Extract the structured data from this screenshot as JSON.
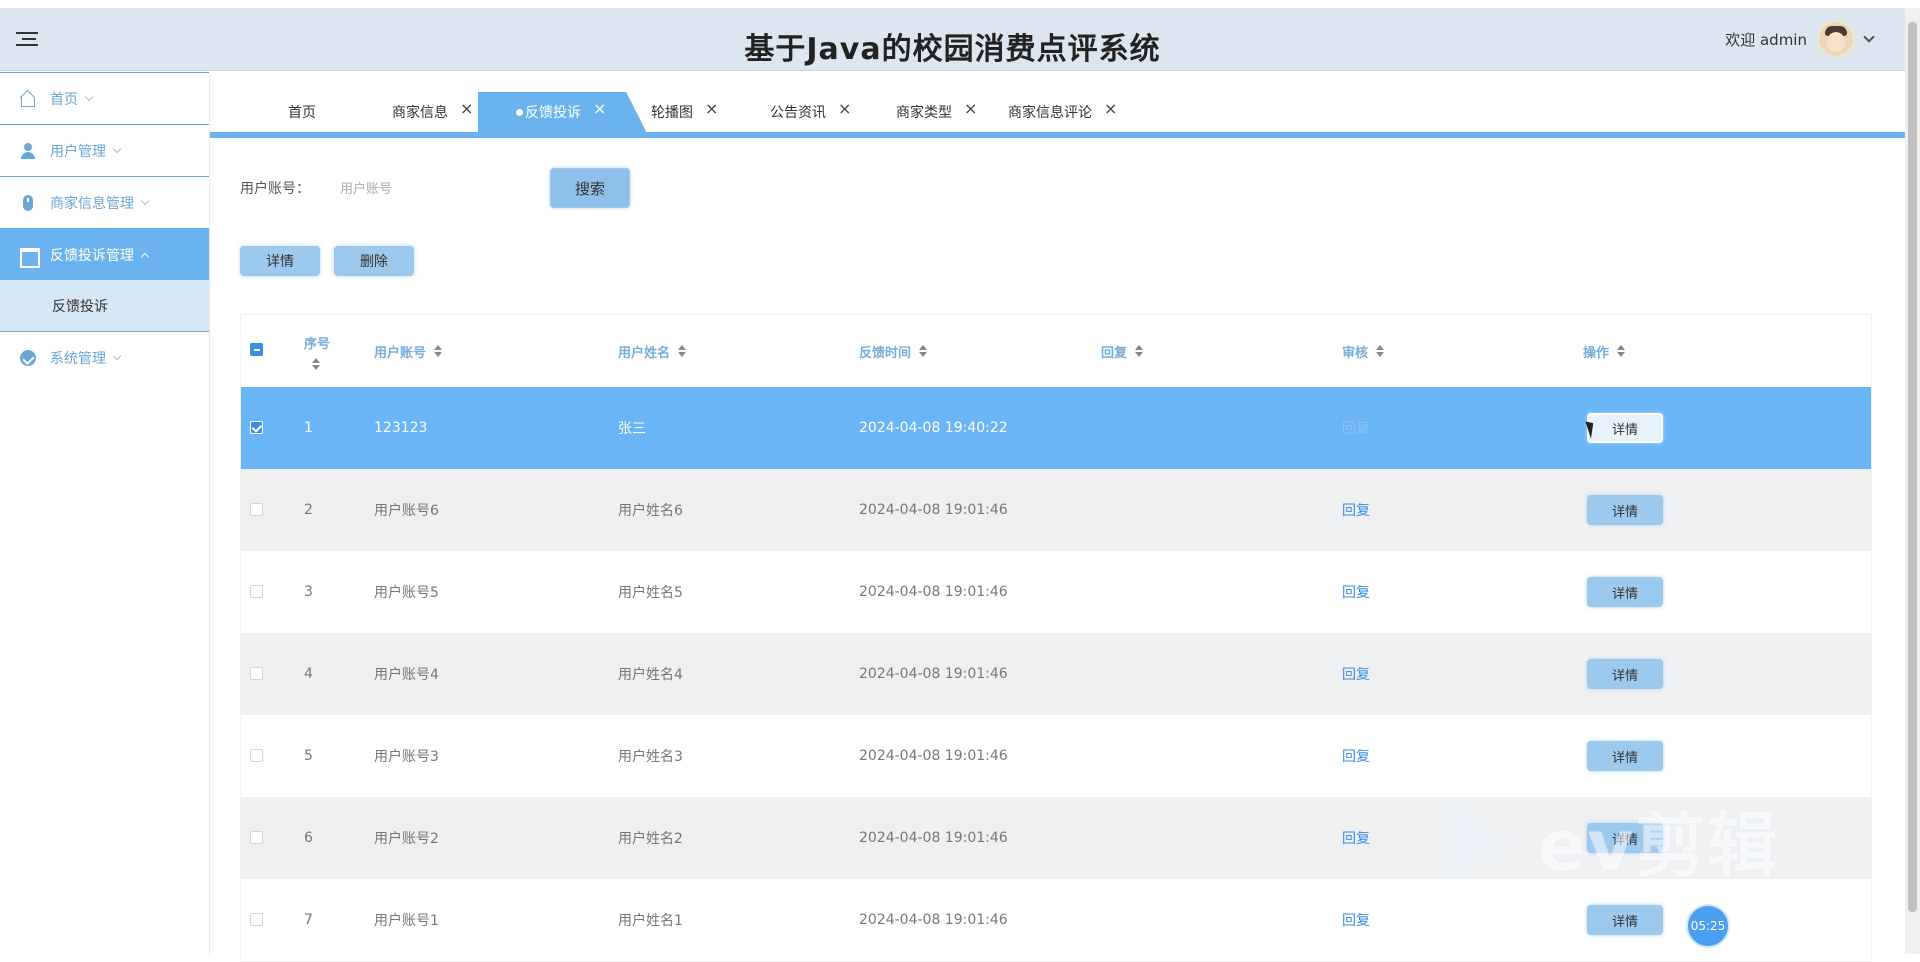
{
  "header": {
    "title": "基于Java的校园消费点评系统",
    "welcome": "欢迎 admin"
  },
  "sidebar": {
    "items": [
      {
        "label": "首页",
        "icon": "home-icon"
      },
      {
        "label": "用户管理",
        "icon": "user-icon"
      },
      {
        "label": "商家信息管理",
        "icon": "merchant-icon"
      },
      {
        "label": "反馈投诉管理",
        "icon": "feedback-icon",
        "active": true
      },
      {
        "label": "系统管理",
        "icon": "system-icon"
      }
    ],
    "sub_item": "反馈投诉"
  },
  "tabs": [
    {
      "label": "首页",
      "closable": false
    },
    {
      "label": "商家信息",
      "closable": true
    },
    {
      "label": "反馈投诉",
      "closable": true,
      "active": true
    },
    {
      "label": "轮播图",
      "closable": true
    },
    {
      "label": "公告资讯",
      "closable": true
    },
    {
      "label": "商家类型",
      "closable": true
    },
    {
      "label": "商家信息评论",
      "closable": true
    }
  ],
  "tab_close": "×",
  "search": {
    "label": "用户账号：",
    "placeholder": "用户账号",
    "button": "搜索"
  },
  "actions": {
    "detail": "详情",
    "delete": "删除"
  },
  "table": {
    "headers": {
      "index": "序号",
      "account": "用户账号",
      "name": "用户姓名",
      "time": "反馈时间",
      "reply": "回复",
      "review": "审核",
      "operation": "操作"
    },
    "reply_link": "回复",
    "detail_button": "详情",
    "rows": [
      {
        "index": "1",
        "account": "123123",
        "name": "张三",
        "time": "2024-04-08 19:40:22",
        "selected": true
      },
      {
        "index": "2",
        "account": "用户账号6",
        "name": "用户姓名6",
        "time": "2024-04-08 19:01:46"
      },
      {
        "index": "3",
        "account": "用户账号5",
        "name": "用户姓名5",
        "time": "2024-04-08 19:01:46"
      },
      {
        "index": "4",
        "account": "用户账号4",
        "name": "用户姓名4",
        "time": "2024-04-08 19:01:46"
      },
      {
        "index": "5",
        "account": "用户账号3",
        "name": "用户姓名3",
        "time": "2024-04-08 19:01:46"
      },
      {
        "index": "6",
        "account": "用户账号2",
        "name": "用户姓名2",
        "time": "2024-04-08 19:01:46"
      },
      {
        "index": "7",
        "account": "用户账号1",
        "name": "用户姓名1",
        "time": "2024-04-08 19:01:46"
      }
    ]
  },
  "overlay": {
    "watermark": "ev剪辑",
    "timer": "05:25"
  },
  "colors": {
    "accent": "#6bb3ee",
    "header_bg": "#dbe6f1",
    "selected_row": "#69b5f6",
    "link": "#3a8ee6"
  }
}
